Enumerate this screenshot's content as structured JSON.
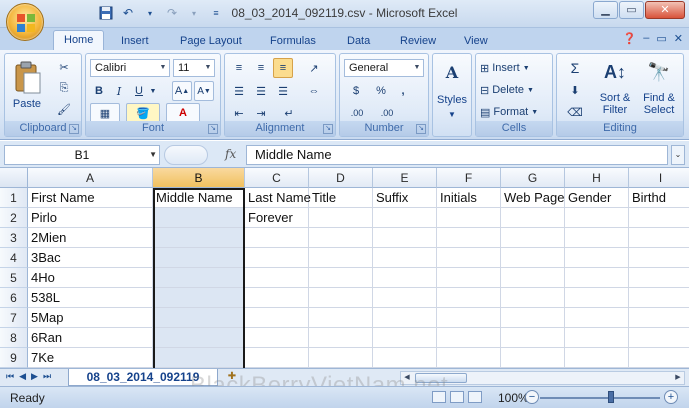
{
  "window": {
    "title": "08_03_2014_092119.csv - Microsoft Excel"
  },
  "ribbon": {
    "tabs": [
      "Home",
      "Insert",
      "Page Layout",
      "Formulas",
      "Data",
      "Review",
      "View"
    ],
    "clipboard": {
      "label": "Clipboard",
      "paste_label": "Paste"
    },
    "font": {
      "label": "Font",
      "name": "Calibri",
      "size": "11"
    },
    "alignment": {
      "label": "Alignment"
    },
    "number": {
      "label": "Number",
      "format": "General",
      "currency": "$",
      "percent": "%",
      "comma": ",",
      "inc_decimal": ".00",
      "dec_decimal": ".00"
    },
    "styles": {
      "label": "Styles"
    },
    "cells": {
      "label": "Cells",
      "insert": "Insert",
      "delete": "Delete",
      "format": "Format"
    },
    "editing": {
      "label": "Editing",
      "sigma": "Σ",
      "sort_filter": "Sort &\nFilter",
      "find_select": "Find &\nSelect"
    }
  },
  "formula_bar": {
    "cell_ref": "B1",
    "fx": "fx",
    "value": "Middle Name"
  },
  "grid": {
    "columns": [
      "A",
      "B",
      "C",
      "D",
      "E",
      "F",
      "G",
      "H",
      "I"
    ],
    "rows": [
      {
        "num": "1",
        "cells": [
          "First Name",
          "Middle Name",
          "Last Name",
          "Title",
          "Suffix",
          "Initials",
          "Web Page",
          "Gender",
          "Birthd"
        ]
      },
      {
        "num": "2",
        "cells": [
          "Pirlo",
          "",
          "Forever",
          "",
          "",
          "",
          "",
          "",
          ""
        ]
      },
      {
        "num": "3",
        "cells": [
          "2Mien",
          "",
          "",
          "",
          "",
          "",
          "",
          "",
          ""
        ]
      },
      {
        "num": "4",
        "cells": [
          "3Bac",
          "",
          "",
          "",
          "",
          "",
          "",
          "",
          ""
        ]
      },
      {
        "num": "5",
        "cells": [
          "4Ho",
          "",
          "",
          "",
          "",
          "",
          "",
          "",
          ""
        ]
      },
      {
        "num": "6",
        "cells": [
          "538L",
          "",
          "",
          "",
          "",
          "",
          "",
          "",
          ""
        ]
      },
      {
        "num": "7",
        "cells": [
          "5Map",
          "",
          "",
          "",
          "",
          "",
          "",
          "",
          ""
        ]
      },
      {
        "num": "8",
        "cells": [
          "6Ran",
          "",
          "",
          "",
          "",
          "",
          "",
          "",
          ""
        ]
      },
      {
        "num": "9",
        "cells": [
          "7Ke",
          "",
          "",
          "",
          "",
          "",
          "",
          "",
          ""
        ]
      }
    ]
  },
  "sheet_tabs": {
    "active": "08_03_2014_092119"
  },
  "status": {
    "ready": "Ready",
    "zoom": "100%"
  },
  "watermark": "BlackBerryVietNam.net",
  "colors": {
    "accent": "#15428b",
    "selected_header": "#f1c15f",
    "ribbon": "#dbe7f6"
  }
}
